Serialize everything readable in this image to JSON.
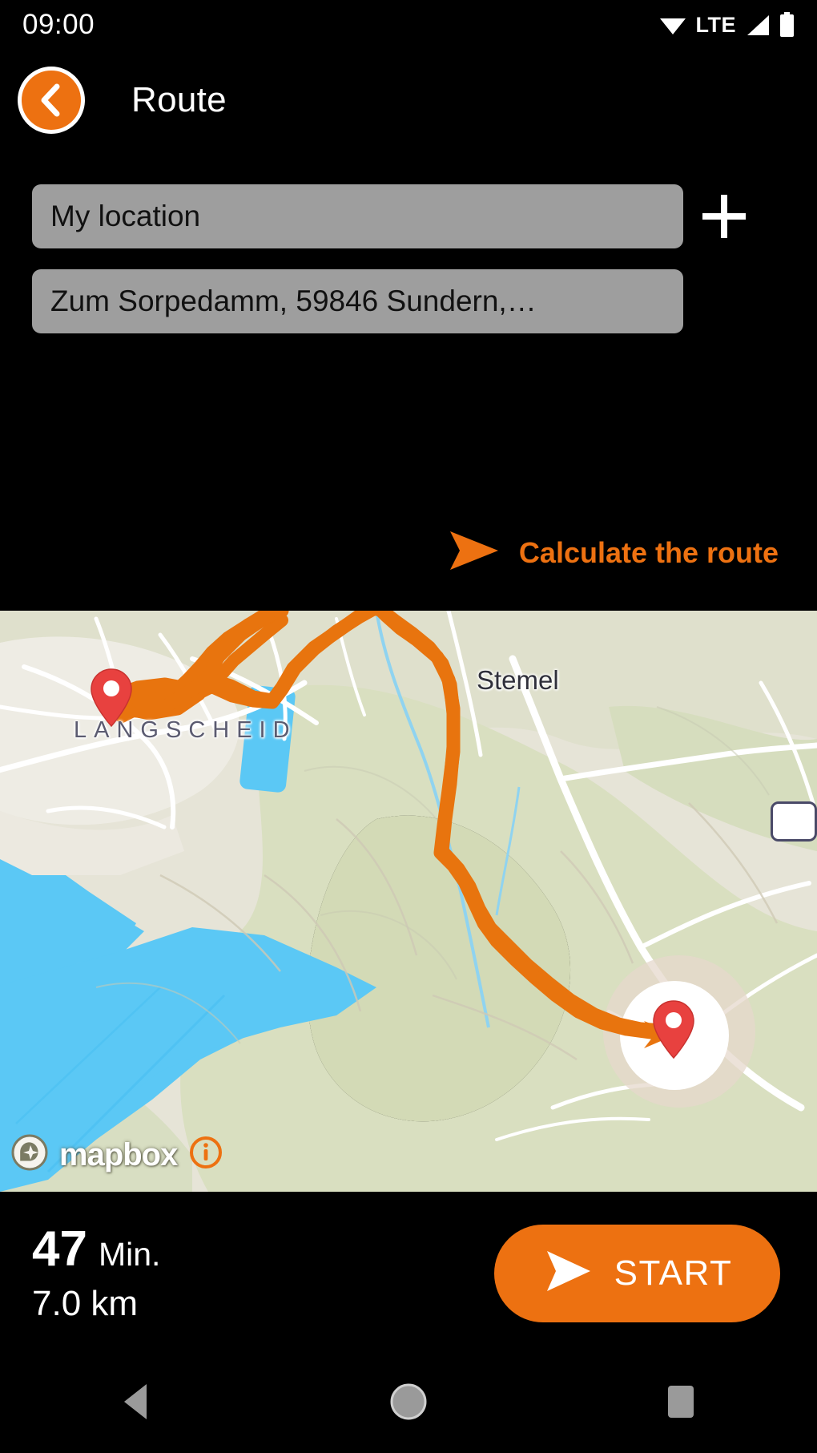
{
  "statusbar": {
    "time": "09:00",
    "network_label": "LTE",
    "icons": [
      "wifi-icon",
      "signal-icon",
      "battery-icon"
    ]
  },
  "header": {
    "title": "Route",
    "back_icon": "chevron-left-icon",
    "accent_color": "#ED7111"
  },
  "form": {
    "origin": {
      "value": "My location",
      "placeholder": "My location"
    },
    "destination": {
      "value": "Zum Sorpedamm, 59846 Sundern,…",
      "placeholder": "Destination"
    },
    "add_waypoint_icon": "plus-icon",
    "calculate": {
      "label": "Calculate the route",
      "icon": "arrow-right-icon"
    }
  },
  "map": {
    "labels": [
      {
        "name": "LANGSCHEID",
        "type": "place"
      },
      {
        "name": "Stemel",
        "type": "place"
      }
    ],
    "markers": [
      {
        "name": "start-marker",
        "color": "#E8413F"
      },
      {
        "name": "destination-marker",
        "color": "#E8413F"
      }
    ],
    "route_color": "#E8740E",
    "water_color": "#5BC8F5",
    "attribution": {
      "logo_text": "mapbox",
      "info_label": "i"
    }
  },
  "bottombar": {
    "duration_value": "47",
    "duration_unit": "Min.",
    "distance": "7.0 km",
    "start_button": {
      "label": "START",
      "icon": "play-arrow-icon",
      "color": "#ED7111"
    }
  },
  "navbar": {
    "back": "back-triangle-icon",
    "home": "home-circle-icon",
    "recents": "recents-square-icon"
  }
}
